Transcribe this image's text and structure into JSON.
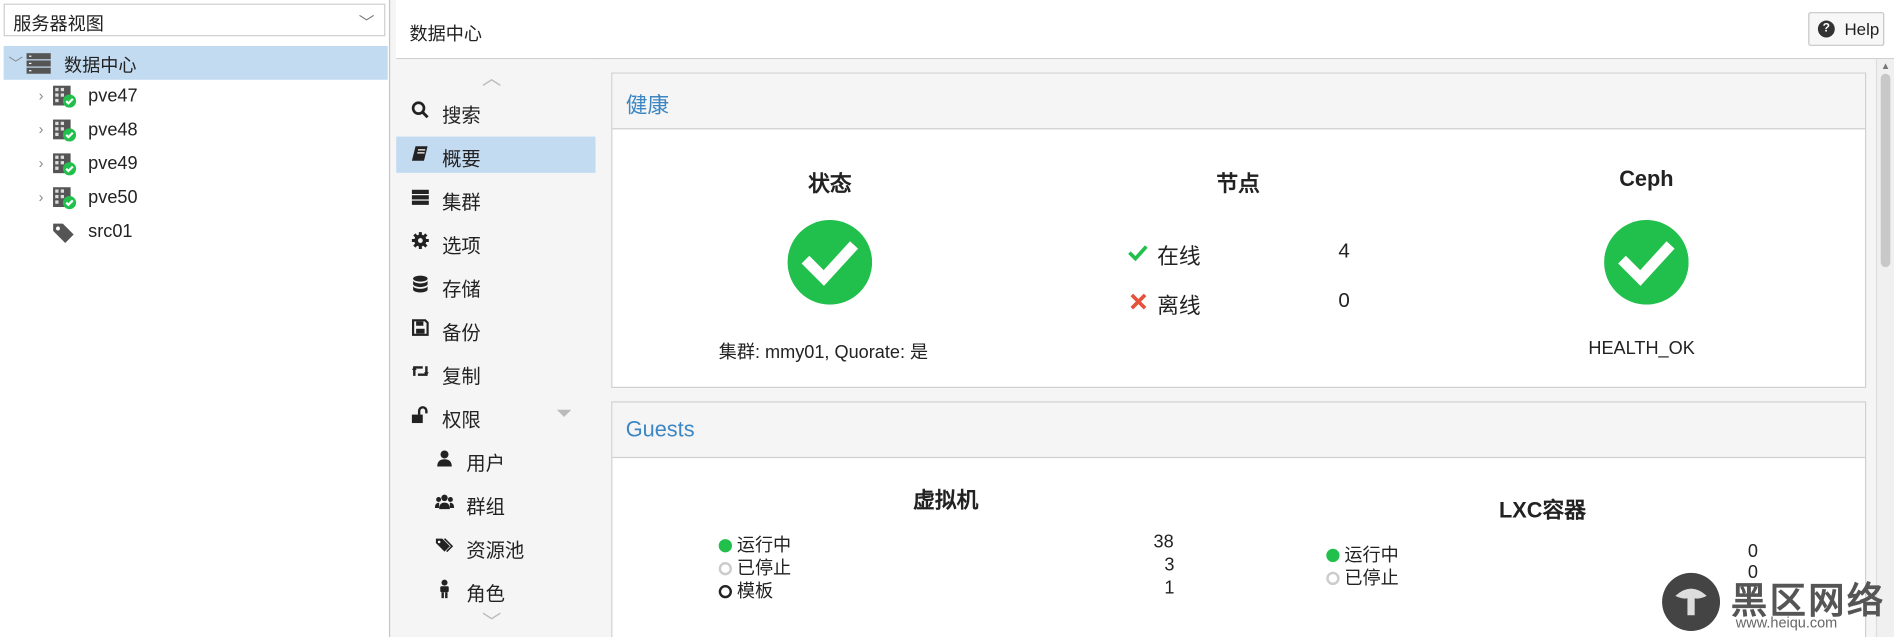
{
  "left": {
    "view_selector": "服务器视图",
    "tree": [
      {
        "label": "数据中心",
        "type": "datacenter",
        "selected": true
      },
      {
        "label": "pve47",
        "type": "node"
      },
      {
        "label": "pve48",
        "type": "node"
      },
      {
        "label": "pve49",
        "type": "node"
      },
      {
        "label": "pve50",
        "type": "node"
      },
      {
        "label": "src01",
        "type": "pool"
      }
    ]
  },
  "header": {
    "title": "数据中心",
    "help_label": "Help"
  },
  "nav": {
    "items": [
      {
        "label": "搜索",
        "icon": "search-icon"
      },
      {
        "label": "概要",
        "icon": "book-icon",
        "selected": true
      },
      {
        "label": "集群",
        "icon": "server-icon"
      },
      {
        "label": "选项",
        "icon": "gear-icon"
      },
      {
        "label": "存储",
        "icon": "database-icon"
      },
      {
        "label": "备份",
        "icon": "floppy-icon"
      },
      {
        "label": "复制",
        "icon": "retweet-icon"
      },
      {
        "label": "权限",
        "icon": "unlock-icon"
      },
      {
        "label": "用户",
        "icon": "user-icon"
      },
      {
        "label": "群组",
        "icon": "users-icon"
      },
      {
        "label": "资源池",
        "icon": "tags-icon"
      },
      {
        "label": "角色",
        "icon": "male-icon"
      }
    ]
  },
  "health": {
    "title": "健康",
    "status": {
      "heading": "状态",
      "text": "集群: mmy01, Quorate: 是"
    },
    "nodes": {
      "heading": "节点",
      "online_label": "在线",
      "online_count": "4",
      "offline_label": "离线",
      "offline_count": "0"
    },
    "ceph": {
      "heading": "Ceph",
      "text": "HEALTH_OK"
    }
  },
  "guests": {
    "title": "Guests",
    "vm": {
      "heading": "虚拟机",
      "running_label": "运行中",
      "running": "38",
      "stopped_label": "已停止",
      "stopped": "3",
      "template_label": "模板",
      "templates": "1"
    },
    "lxc": {
      "heading": "LXC容器",
      "running_label": "运行中",
      "running": "0",
      "stopped_label": "已停止",
      "stopped": "0"
    }
  },
  "watermark": {
    "text": "黑区网络",
    "url": "www.heiqu.com"
  },
  "colors": {
    "accent": "#3c87c3",
    "ok": "#21bf4b",
    "error": "#e5533d",
    "selected": "#c3dbf1"
  }
}
